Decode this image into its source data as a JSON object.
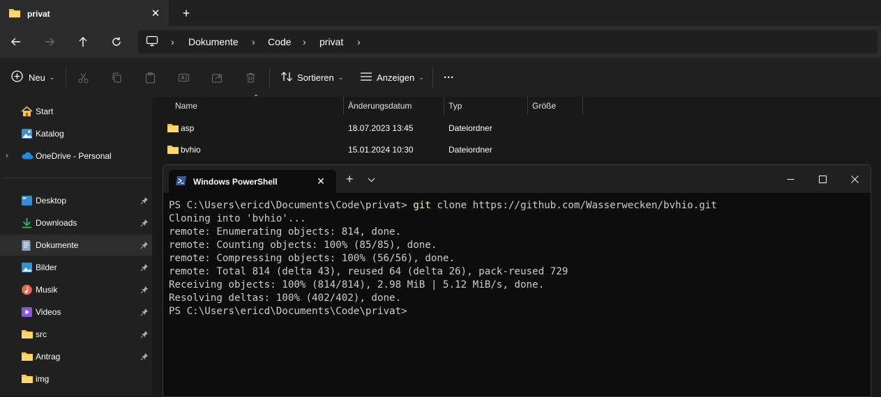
{
  "explorer": {
    "tab": {
      "title": "privat",
      "close": "✕",
      "new_tab": "+"
    },
    "breadcrumb": [
      "Dokumente",
      "Code",
      "privat"
    ],
    "commandbar": {
      "new_label": "Neu",
      "sort_label": "Sortieren",
      "view_label": "Anzeigen",
      "more_label": "···"
    },
    "sidebar": {
      "top": [
        {
          "label": "Start",
          "icon": "home-icon"
        },
        {
          "label": "Katalog",
          "icon": "gallery-icon"
        },
        {
          "label": "OneDrive - Personal",
          "icon": "cloud-icon"
        }
      ],
      "pinned": [
        {
          "label": "Desktop",
          "icon": "desktop-icon",
          "pinned": true
        },
        {
          "label": "Downloads",
          "icon": "download-icon",
          "pinned": true
        },
        {
          "label": "Dokumente",
          "icon": "document-icon",
          "pinned": true,
          "selected": true
        },
        {
          "label": "Bilder",
          "icon": "picture-icon",
          "pinned": true
        },
        {
          "label": "Musik",
          "icon": "music-icon",
          "pinned": true
        },
        {
          "label": "Videos",
          "icon": "video-icon",
          "pinned": true
        },
        {
          "label": "src",
          "icon": "folder-icon",
          "pinned": true
        },
        {
          "label": "Antrag",
          "icon": "folder-icon",
          "pinned": true
        },
        {
          "label": "img",
          "icon": "folder-icon",
          "pinned": false
        }
      ]
    },
    "columns": {
      "name": "Name",
      "date": "Änderungsdatum",
      "type": "Typ",
      "size": "Größe"
    },
    "files": [
      {
        "name": "asp",
        "date": "18.07.2023 13:45",
        "type": "Dateiordner"
      },
      {
        "name": "bvhio",
        "date": "15.01.2024 10:30",
        "type": "Dateiordner"
      }
    ]
  },
  "terminal": {
    "tab_title": "Windows PowerShell",
    "lines": {
      "prompt1": "PS C:\\Users\\ericd\\Documents\\Code\\privat> ",
      "cmd_git": "git",
      "cmd_rest": " clone https://github.com/Wasserwecken/bvhio.git",
      "l2": "Cloning into 'bvhio'...",
      "l3": "remote: Enumerating objects: 814, done.",
      "l4": "remote: Counting objects: 100% (85/85), done.",
      "l5": "remote: Compressing objects: 100% (56/56), done.",
      "l6": "remote: Total 814 (delta 43), reused 64 (delta 26), pack-reused 729",
      "l7": "Receiving objects: 100% (814/814), 2.98 MiB | 5.12 MiB/s, done.",
      "l8": "Resolving deltas: 100% (402/402), done.",
      "l9": "PS C:\\Users\\ericd\\Documents\\Code\\privat>"
    }
  },
  "colors": {
    "folder": "#f8c549",
    "accent": "#4ea1e8",
    "terminal_bg": "#0c0c0c"
  }
}
